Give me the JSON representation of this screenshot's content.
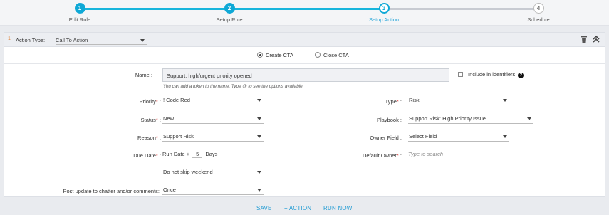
{
  "stepper": {
    "steps": [
      {
        "num": "1",
        "label": "Edit Rule"
      },
      {
        "num": "2",
        "label": "Setup Rule"
      },
      {
        "num": "3",
        "label": "Setup Action"
      },
      {
        "num": "4",
        "label": "Schedule"
      }
    ]
  },
  "action": {
    "index": "1",
    "type_label": "Action Type:",
    "type_value": "Call To Action"
  },
  "mode": {
    "create_label": "Create CTA",
    "close_label": "Close CTA",
    "selected": "Create CTA"
  },
  "form": {
    "name_label": "Name :",
    "name_value": "Support: high/urgent priority opened",
    "name_hint": "You can add a token to the name. Type @ to see the options available.",
    "include_identifiers": "Include in identifiers",
    "priority_label": "Priority",
    "priority_value": "! Code Red",
    "status_label": "Status",
    "status_value": "New",
    "reason_label": "Reason",
    "reason_value": "Support Risk",
    "due_label": "Due Date",
    "due_prefix": "Run Date +",
    "due_days": "5",
    "due_suffix": "Days",
    "skip_weekend": "Do not skip weekend",
    "post_label": "Post update to chatter and/or comments:",
    "post_value": "Once",
    "type_label": "Type",
    "type_value": "Risk",
    "playbook_label": "Playbook :",
    "playbook_value": "Support Risk: High Priority Issue",
    "owner_field_label": "Owner Field :",
    "owner_field_value": "Select Field",
    "default_owner_label": "Default Owner",
    "default_owner_placeholder": "Type to search"
  },
  "footer": {
    "save": "SAVE",
    "add_action": "+ ACTION",
    "run_now": "RUN NOW"
  },
  "colors": {
    "accent": "#0fa8d6",
    "required": "#e0403c"
  }
}
